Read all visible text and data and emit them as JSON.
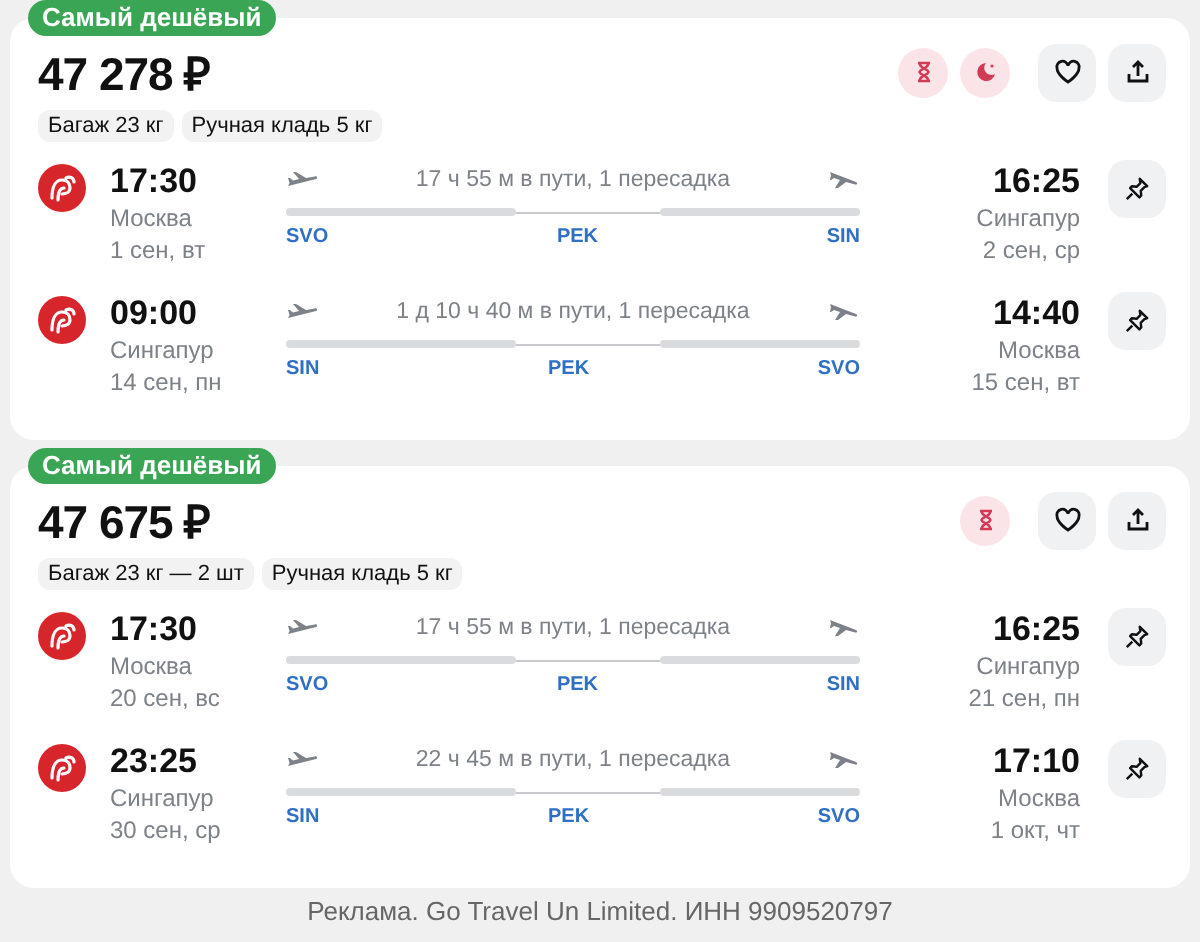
{
  "offers": [
    {
      "badge": "Самый дешёвый",
      "price": "47 278 ₽",
      "long_transfer": true,
      "night_transfer": true,
      "tags": [
        "Багаж 23 кг",
        "Ручная кладь 5 кг"
      ],
      "legs": [
        {
          "dep_time": "17:30",
          "dep_city": "Москва",
          "dep_date": "1 сен, вт",
          "duration": "17 ч 55 м в пути, 1 пересадка",
          "from": "SVO",
          "stop": "PEK",
          "to": "SIN",
          "arr_time": "16:25",
          "arr_city": "Сингапур",
          "arr_date": "2 сен, ср"
        },
        {
          "dep_time": "09:00",
          "dep_city": "Сингапур",
          "dep_date": "14 сен, пн",
          "duration": "1 д 10 ч 40 м в пути, 1 пересадка",
          "from": "SIN",
          "stop": "PEK",
          "to": "SVO",
          "arr_time": "14:40",
          "arr_city": "Москва",
          "arr_date": "15 сен, вт"
        }
      ]
    },
    {
      "badge": "Самый дешёвый",
      "price": "47 675 ₽",
      "long_transfer": true,
      "night_transfer": false,
      "tags": [
        "Багаж 23 кг — 2 шт",
        "Ручная кладь 5 кг"
      ],
      "legs": [
        {
          "dep_time": "17:30",
          "dep_city": "Москва",
          "dep_date": "20 сен, вс",
          "duration": "17 ч 55 м в пути, 1 пересадка",
          "from": "SVO",
          "stop": "PEK",
          "to": "SIN",
          "arr_time": "16:25",
          "arr_city": "Сингапур",
          "arr_date": "21 сен, пн"
        },
        {
          "dep_time": "23:25",
          "dep_city": "Сингапур",
          "dep_date": "30 сен, ср",
          "duration": "22 ч 45 м в пути, 1 пересадка",
          "from": "SIN",
          "stop": "PEK",
          "to": "SVO",
          "arr_time": "17:10",
          "arr_city": "Москва",
          "arr_date": "1 окт, чт"
        }
      ]
    }
  ],
  "footer": "Реклама. Go Travel Un Limited. ИНН 9909520797"
}
